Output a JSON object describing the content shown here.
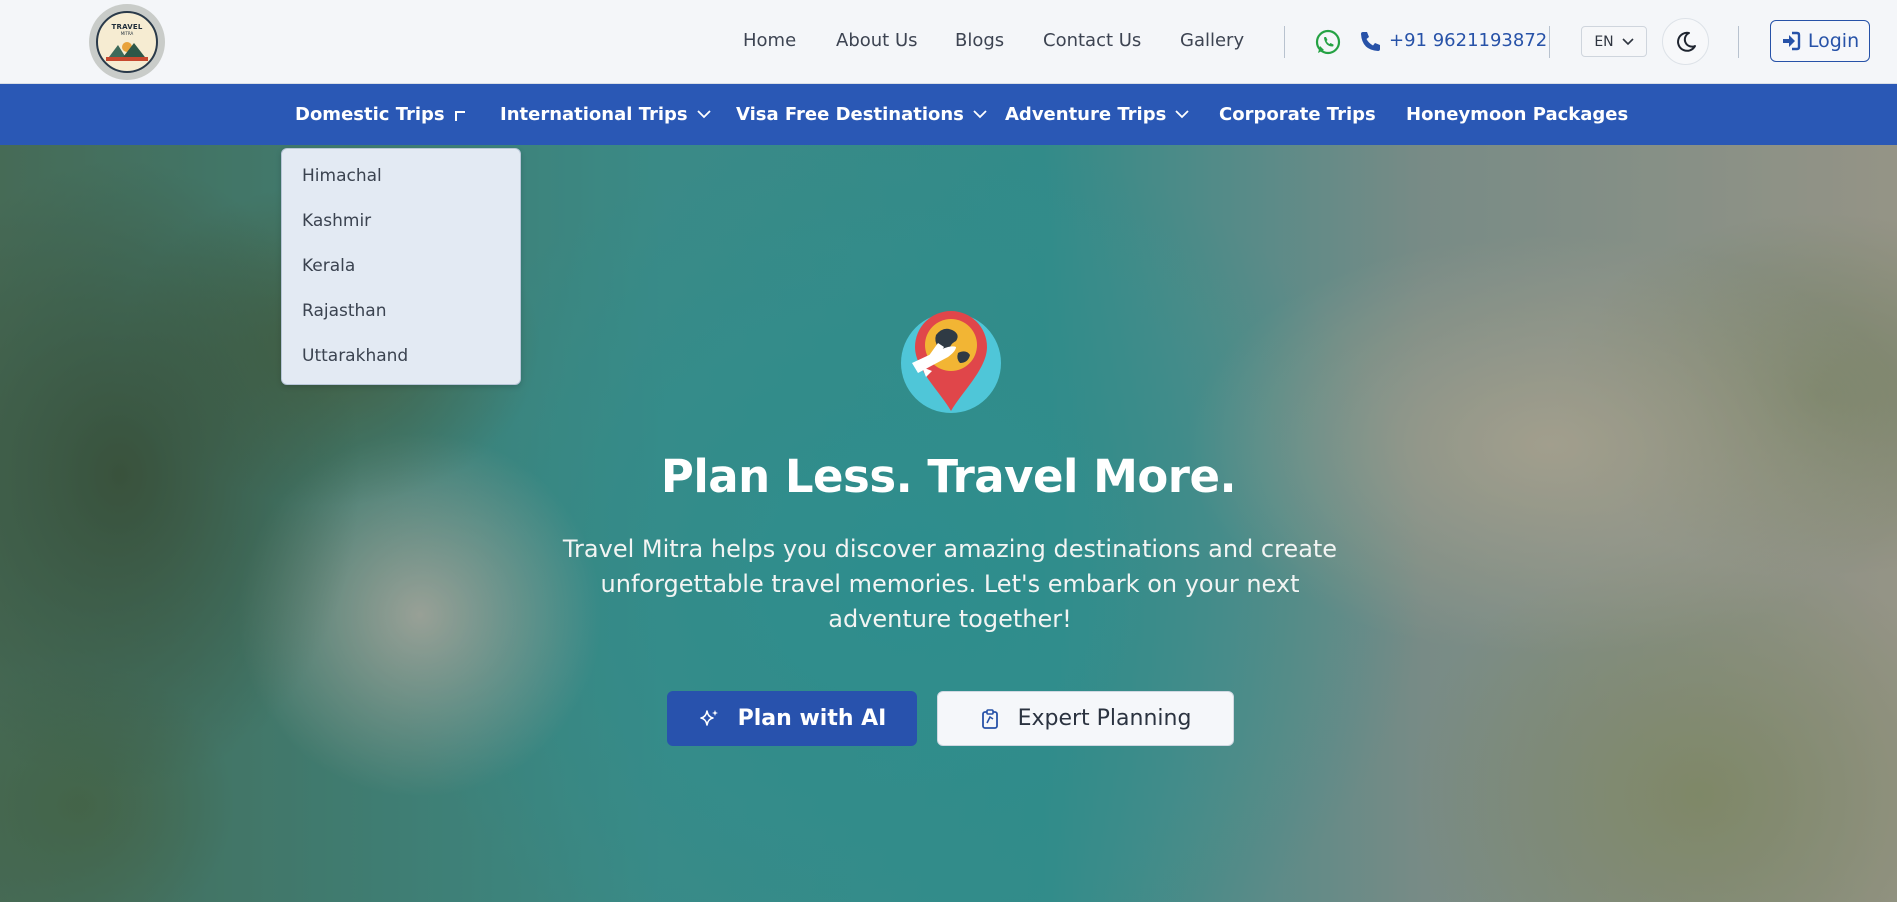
{
  "brand": {
    "logo_title": "TRAVEL",
    "logo_sub": "MITRA"
  },
  "top_nav": {
    "links": [
      "Home",
      "About Us",
      "Blogs",
      "Contact Us",
      "Gallery"
    ],
    "phone": "+91 9621193872",
    "language": "EN",
    "login_label": "Login"
  },
  "category_nav": {
    "items": [
      {
        "label": "Domestic Trips",
        "has_dropdown": true,
        "open": true
      },
      {
        "label": "International Trips",
        "has_dropdown": true
      },
      {
        "label": "Visa Free Destinations",
        "has_dropdown": true
      },
      {
        "label": "Adventure Trips",
        "has_dropdown": true
      },
      {
        "label": "Corporate Trips",
        "has_dropdown": false
      },
      {
        "label": "Honeymoon Packages",
        "has_dropdown": false
      }
    ]
  },
  "dropdown": {
    "items": [
      "Himachal",
      "Kashmir",
      "Kerala",
      "Rajasthan",
      "Uttarakhand"
    ]
  },
  "hero": {
    "title": "Plan Less. Travel More.",
    "description_lines": [
      "Travel Mitra helps you discover amazing destinations and create",
      "unforgettable travel memories. Let's embark on your next",
      "adventure together!"
    ],
    "primary_button": "Plan with AI",
    "secondary_button": "Expert Planning"
  },
  "colors": {
    "brand_blue": "#2a58b5",
    "phone_blue": "#2752a8",
    "whatsapp_green": "#25a244"
  },
  "icons": [
    "whatsapp-icon",
    "phone-icon",
    "chevron-down-icon",
    "moon-icon",
    "login-icon",
    "sparkle-icon",
    "clipboard-icon",
    "travel-pin-icon"
  ]
}
